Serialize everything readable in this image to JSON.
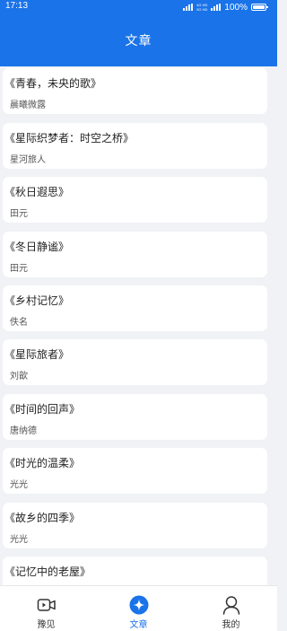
{
  "status_bar": {
    "time": "17:13",
    "network_text": "4G HD\n5G HD",
    "battery_percent": "100%"
  },
  "header": {
    "title": "文章"
  },
  "articles": [
    {
      "title": "《青春，未央的歌》",
      "author": "晨曦微露"
    },
    {
      "title": "《星际织梦者：时空之桥》",
      "author": "星河旅人"
    },
    {
      "title": "《秋日遐思》",
      "author": "田元"
    },
    {
      "title": "《冬日静谧》",
      "author": "田元"
    },
    {
      "title": "《乡村记忆》",
      "author": "佚名"
    },
    {
      "title": "《星际旅者》",
      "author": "刘歆"
    },
    {
      "title": "《时间的回声》",
      "author": "唐纳德"
    },
    {
      "title": "《时光的温柔》",
      "author": "光光"
    },
    {
      "title": "《故乡的四季》",
      "author": "光光"
    },
    {
      "title": "《记忆中的老屋》",
      "author": ""
    }
  ],
  "tabbar": {
    "items": [
      {
        "label": "豫见",
        "icon": "video-icon",
        "active": false
      },
      {
        "label": "文章",
        "icon": "star-icon",
        "active": true
      },
      {
        "label": "我的",
        "icon": "user-icon",
        "active": false
      }
    ]
  },
  "colors": {
    "primary": "#1a73e8",
    "background": "#f0f2f5",
    "card": "#ffffff"
  }
}
